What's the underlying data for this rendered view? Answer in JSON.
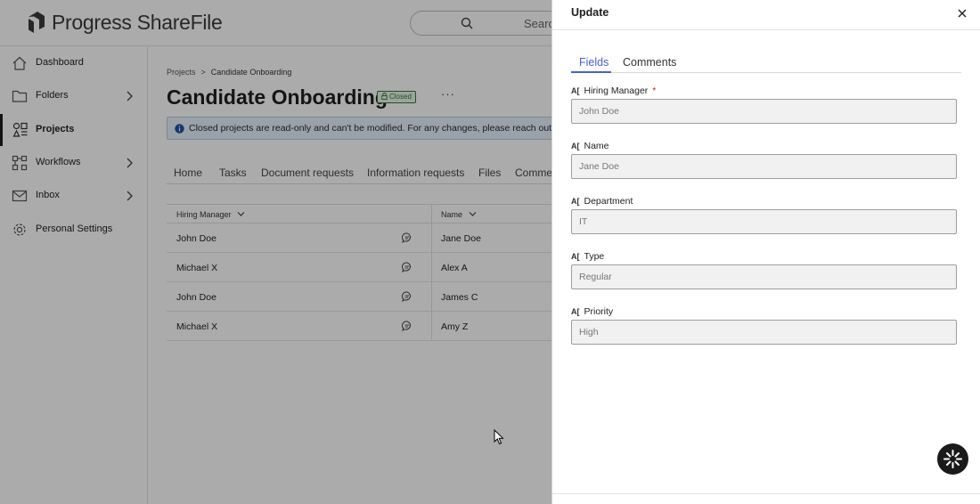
{
  "app": {
    "brand": "Progress ShareFile",
    "search_placeholder": "Search"
  },
  "sidebar": {
    "items": [
      {
        "label": "Dashboard",
        "icon": "home-icon"
      },
      {
        "label": "Folders",
        "icon": "folder-icon"
      },
      {
        "label": "Projects",
        "icon": "projects-icon"
      },
      {
        "label": "Workflows",
        "icon": "workflows-icon"
      },
      {
        "label": "Inbox",
        "icon": "inbox-icon"
      },
      {
        "label": "Personal Settings",
        "icon": "gear-icon"
      }
    ]
  },
  "main": {
    "breadcrumb": {
      "root": "Projects",
      "separator": ">",
      "current": "Candidate Onboarding"
    },
    "title": "Candidate Onboarding",
    "status_badge": "Closed",
    "more_label": "···",
    "banner_text": "Closed projects are read-only and can't be modified. For any changes, please reach out to the",
    "tabs": [
      "Home",
      "Tasks",
      "Document requests",
      "Information requests",
      "Files",
      "Comments"
    ],
    "table": {
      "columns": [
        "Hiring Manager",
        "Name"
      ],
      "rows": [
        {
          "hiring_manager": "John Doe",
          "name": "Jane Doe"
        },
        {
          "hiring_manager": "Michael X",
          "name": "Alex A"
        },
        {
          "hiring_manager": "John Doe",
          "name": "James C"
        },
        {
          "hiring_manager": "Michael X",
          "name": "Amy Z"
        }
      ]
    }
  },
  "drawer": {
    "title": "Update",
    "tabs": [
      "Fields",
      "Comments"
    ],
    "active_tab": "Fields",
    "fields": [
      {
        "label": "Hiring Manager",
        "required": true,
        "required_mark": "*",
        "value": "John Doe"
      },
      {
        "label": "Name",
        "required": false,
        "value": "Jane Doe"
      },
      {
        "label": "Department",
        "required": false,
        "value": "IT"
      },
      {
        "label": "Type",
        "required": false,
        "value": "Regular"
      },
      {
        "label": "Priority",
        "required": false,
        "value": "High"
      }
    ],
    "field_type_icon": "text-field-icon",
    "field_type_glyph": "A["
  },
  "colors": {
    "accent": "#4b5ed6",
    "required": "#c62828",
    "closed_badge": "#2e7d32",
    "banner_bg": "#e8f0fb",
    "overlay": "rgba(0,0,0,0.33)"
  }
}
